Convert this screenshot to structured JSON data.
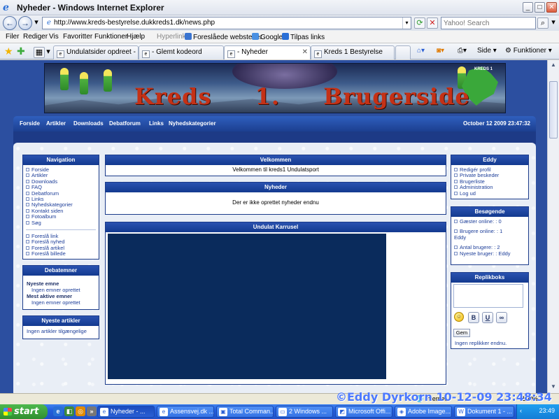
{
  "window": {
    "title": "Nyheder - Windows Internet Explorer",
    "min": "_",
    "max": "□",
    "close": "✕"
  },
  "address": {
    "url": "http://www.kreds-bestyrelse.dukkreds1.dk/news.php",
    "search_placeholder": "Yahoo! Search",
    "back": "←",
    "forward": "→"
  },
  "menubar": {
    "items": [
      "Filer",
      "Rediger",
      "Vis",
      "Favoritter",
      "Funktioner",
      "Hjælp"
    ],
    "links_label": "Hyperlinks",
    "suggested_sites": "Foreslåede websteder",
    "google": "Google",
    "add_links": "Tilpas links"
  },
  "tabs": [
    {
      "label": "Undulatsider opdreet - Ed.Dy..."
    },
    {
      "label": "- Glemt kodeord"
    },
    {
      "label": "- Nyheder"
    },
    {
      "label": "Kreds 1 Bestyrelse"
    }
  ],
  "toolbar_right": {
    "page": "Side",
    "tools": "Funktioner"
  },
  "site": {
    "banner_title": "Kreds 1. Brugerside",
    "banner_logo": "KREDS 1",
    "nav_links": [
      "Forside",
      "Artikler",
      "Downloads",
      "Debatforum",
      "Links",
      "Nyhedskategorier"
    ],
    "date": "October 12 2009 23:47:32"
  },
  "navigation": {
    "title": "Navigation",
    "items": [
      "Forside",
      "Artikler",
      "Downloads",
      "FAQ",
      "Debatforum",
      "Links",
      "Nyhedskategorier",
      "Kontakt siden",
      "Fotoalbum",
      "Søg"
    ],
    "suggest_items": [
      "Foreslå link",
      "Foreslå nyhed",
      "Foreslå artikel",
      "Foreslå billede"
    ]
  },
  "debatemner": {
    "title": "Debatemner",
    "newest_label": "Nyeste emne",
    "newest_value": "Ingen emner oprettet",
    "most_active_label": "Mest aktive emner",
    "most_active_value": "Ingen emner oprettet"
  },
  "nyeste_artikler": {
    "title": "Nyeste artikler",
    "text": "Ingen artikler tilgængelige"
  },
  "velkommen": {
    "title": "Velkommen",
    "text": "Velkommen til kreds1 Undulatsport"
  },
  "nyheder": {
    "title": "Nyheder",
    "text": "Der er ikke oprettet nyheder endnu"
  },
  "karrusel": {
    "title": "Undulat Karrusel"
  },
  "user_panel": {
    "title": "Eddy",
    "items": [
      "Redigér profil",
      "Private beskeder",
      "Brugerliste",
      "Administration",
      "Log ud"
    ]
  },
  "visitors": {
    "title": "Besøgende",
    "guests": "Gæster online: : 0",
    "users_online": "Brugere online: : 1",
    "users_online_name": "Eddy",
    "total_users": "Antal brugere: : 2",
    "newest_user": "Nyeste bruger: : Eddy"
  },
  "replikboks": {
    "title": "Replikboks",
    "bold": "B",
    "underline": "U",
    "link": "∞",
    "submit": "Gem",
    "empty_text": "Ingen replikker endnu."
  },
  "statusbar": {
    "zone": "Internet",
    "zoom": "100%",
    "watermark": "©Eddy Dyrkorn  10-12-09 23:48:34"
  },
  "taskbar": {
    "start": "start",
    "tasks": [
      "Nyheder - ...",
      "Assensvej.dk ...",
      "Total Comman...",
      "2 Windows ...",
      "Microsoft Offi...",
      "Adobe Image...",
      "Dokument 1 - ..."
    ],
    "clock": "23:49"
  }
}
